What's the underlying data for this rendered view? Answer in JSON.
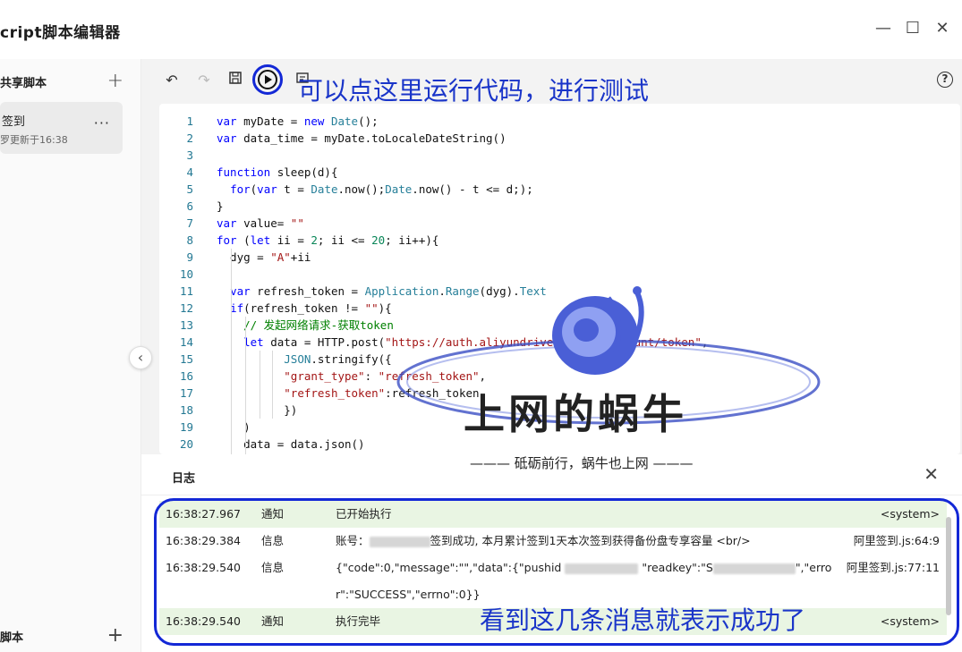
{
  "window": {
    "title": "cript脚本编辑器",
    "minimize_icon": "—",
    "maximize_icon": "☐",
    "close_icon": "✕"
  },
  "sidebar": {
    "shared_header": "共享脚本",
    "add_icon": "+",
    "items": [
      {
        "name": "签到",
        "updated": "罗更新于16:38",
        "more": "···"
      }
    ],
    "footer_header": "脚本",
    "collapse_icon": "‹"
  },
  "toolbar": {
    "undo": "↶",
    "redo": "↷",
    "save": "🖫",
    "help": "?"
  },
  "annotations": {
    "run_hint": "可以点这里运行代码，进行测试",
    "success_hint": "看到这几条消息就表示成功了",
    "accent_color": "#1328d6"
  },
  "watermark": {
    "name": "上网的蜗牛",
    "slogan": "——— 砥砺前行，蜗牛也上网 ———"
  },
  "editor": {
    "lines": [
      {
        "n": "1",
        "html": "<span class=\"tok-kw\">var</span> myDate = <span class=\"tok-kw\">new</span> <span class=\"tok-cls\">Date</span>();"
      },
      {
        "n": "2",
        "html": "<span class=\"tok-kw\">var</span> data_time = myDate.toLocaleDateString()"
      },
      {
        "n": "3",
        "html": ""
      },
      {
        "n": "4",
        "html": "<span class=\"tok-kw\">function</span> sleep(d){"
      },
      {
        "n": "5",
        "html": "  <span class=\"tok-kw\">for</span>(<span class=\"tok-kw\">var</span> t = <span class=\"tok-cls\">Date</span>.now();<span class=\"tok-cls\">Date</span>.now() - t &lt;= d;);"
      },
      {
        "n": "6",
        "html": "}"
      },
      {
        "n": "7",
        "html": "<span class=\"tok-kw\">var</span> value= <span class=\"tok-str\">\"\"</span>"
      },
      {
        "n": "8",
        "html": "<span class=\"tok-kw\">for</span> (<span class=\"tok-kw\">let</span> ii = <span class=\"tok-num\">2</span>; ii &lt;= <span class=\"tok-num\">20</span>; ii++){"
      },
      {
        "n": "9",
        "html": "  dyg = <span class=\"tok-str\">\"A\"</span>+ii"
      },
      {
        "n": "10",
        "html": ""
      },
      {
        "n": "11",
        "html": "  <span class=\"tok-kw\">var</span> refresh_token = <span class=\"tok-cls\">Application</span>.<span class=\"tok-cls\">Range</span>(dyg).<span class=\"tok-cls\">Text</span>"
      },
      {
        "n": "12",
        "html": "  <span class=\"tok-kw\">if</span>(refresh_token != <span class=\"tok-str\">\"\"</span>){"
      },
      {
        "n": "13",
        "html": "    <span class=\"tok-com\">// 发起网络请求-获取token</span>"
      },
      {
        "n": "14",
        "html": "    <span class=\"tok-kw\">let</span> data = HTTP.post(<span class=\"tok-str\">\"https://auth.aliyundrive.com/v2/account/token\"</span>,"
      },
      {
        "n": "15",
        "html": "          <span class=\"tok-cls\">JSON</span>.stringify({"
      },
      {
        "n": "16",
        "html": "          <span class=\"tok-str\">\"grant_type\"</span>: <span class=\"tok-str\">\"refresh_token\"</span>,"
      },
      {
        "n": "17",
        "html": "          <span class=\"tok-str\">\"refresh_token\"</span>:refresh_token"
      },
      {
        "n": "18",
        "html": "          })"
      },
      {
        "n": "19",
        "html": "    )"
      },
      {
        "n": "20",
        "html": "    data = data.json()"
      }
    ]
  },
  "log": {
    "title": "日志",
    "close_icon": "✕",
    "rows": [
      {
        "time": "16:38:27.967",
        "level": "通知",
        "msg": "已开始执行",
        "src": "<system>"
      },
      {
        "time": "16:38:29.384",
        "level": "信息",
        "msg_pre": "账号：",
        "msg_post": "签到成功, 本月累计签到1天本次签到获得备份盘专享容量 <br/>",
        "src": "阿里签到.js:64:9"
      },
      {
        "time": "16:38:29.540",
        "level": "信息",
        "msg_a": "{\"code\":0,\"message\":\"\",\"data\":{\"pushid",
        "msg_b": "\"readkey\":\"S",
        "msg_c": "\",\"erro",
        "msg_d": "r\":\"SUCCESS\",\"errno\":0}}",
        "src": "阿里签到.js:77:11"
      },
      {
        "time": "16:38:29.540",
        "level": "通知",
        "msg": "执行完毕",
        "src": "<system>"
      }
    ]
  }
}
